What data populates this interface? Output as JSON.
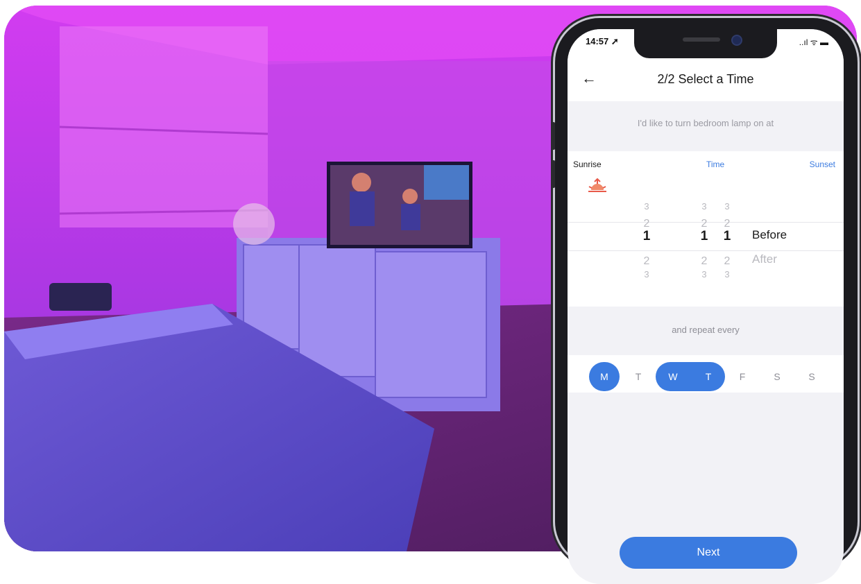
{
  "status": {
    "time": "14:57 ➚",
    "icons": "..ıl ᯤ ▬"
  },
  "nav": {
    "title": "2/2 Select a Time",
    "back_icon": "←"
  },
  "prompt": "I'd like to turn bedroom lamp on at",
  "picker": {
    "modes": {
      "sunrise": "Sunrise",
      "time": "Time",
      "sunset": "Sunset"
    },
    "columns": [
      {
        "above2": "3",
        "above1": "2",
        "selected": "1",
        "below1": "2",
        "below2": "3"
      },
      {
        "above2": "3",
        "above1": "2",
        "selected": "1",
        "below1": "2",
        "below2": "3"
      },
      {
        "above2": "3",
        "above1": "2",
        "selected": "1",
        "below1": "2",
        "below2": "3"
      }
    ],
    "before": "Before",
    "after": "After",
    "accent": "#3b7be0",
    "sun_icon": "sunrise-icon"
  },
  "repeat_label": "and repeat every",
  "days": [
    {
      "label": "M",
      "selected": true
    },
    {
      "label": "T",
      "selected": false
    },
    {
      "label": "W",
      "selected": true
    },
    {
      "label": "T",
      "selected": true
    },
    {
      "label": "F",
      "selected": false
    },
    {
      "label": "S",
      "selected": false
    },
    {
      "label": "S",
      "selected": false
    }
  ],
  "next_label": "Next"
}
